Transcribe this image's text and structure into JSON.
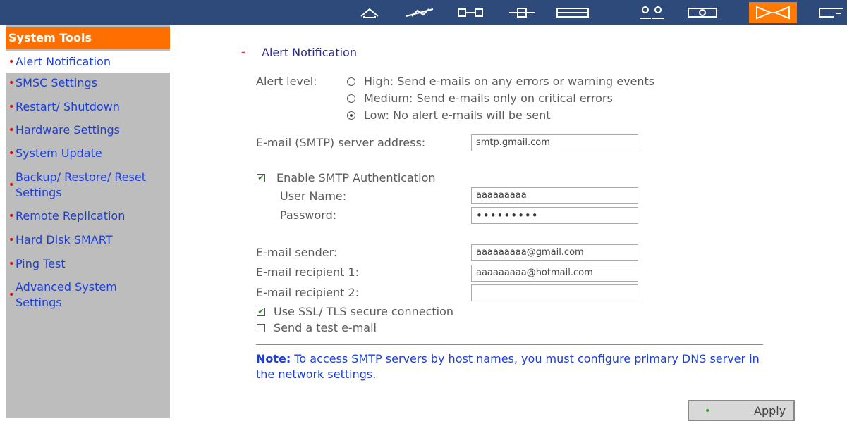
{
  "toolbar": {
    "icons": [
      "home-icon",
      "quick-config-icon",
      "system-settings-icon",
      "network-icon",
      "device-config-icon",
      "user-management-icon",
      "network-share-icon",
      "system-tools-icon",
      "logout-icon"
    ],
    "active_icon": "system-tools-icon",
    "accent_color": "#ff7a00",
    "background_color": "#2e4a7a"
  },
  "sidebar": {
    "title": "System Tools",
    "items": [
      {
        "label": "Alert Notification",
        "active": true
      },
      {
        "label": "SMSC Settings"
      },
      {
        "label": "Restart/ Shutdown"
      },
      {
        "label": "Hardware Settings"
      },
      {
        "label": "System Update"
      },
      {
        "label": "Backup/ Restore/ Reset Settings"
      },
      {
        "label": "Remote Replication"
      },
      {
        "label": "Hard Disk SMART"
      },
      {
        "label": "Ping Test"
      },
      {
        "label": "Advanced System Settings"
      }
    ],
    "title_color": "#ff6f00",
    "link_color": "#1c3fd6",
    "bullet": "•"
  },
  "main": {
    "section_dash": "-",
    "section_title": "Alert Notification",
    "alert_level_label": "Alert level:",
    "alert_options": [
      {
        "label": "High: Send e-mails on any errors or warning events",
        "selected": false
      },
      {
        "label": "Medium: Send e-mails only on critical errors",
        "selected": false
      },
      {
        "label": "Low: No alert e-mails will be sent",
        "selected": true
      }
    ],
    "smtp_server_label": "E-mail (SMTP) server address:",
    "smtp_server_value": "smtp.gmail.com",
    "enable_auth_label": "Enable SMTP Authentication",
    "enable_auth_checked": true,
    "username_label": "User Name:",
    "username_value": "aaaaaaaaa",
    "password_label": "Password:",
    "password_value": "•••••••••",
    "sender_label": "E-mail sender:",
    "sender_value": "aaaaaaaaa@gmail.com",
    "recipient1_label": "E-mail recipient 1:",
    "recipient1_value": "aaaaaaaaa@hotmail.com",
    "recipient2_label": "E-mail recipient 2:",
    "recipient2_value": "",
    "ssl_label": "Use SSL/ TLS secure connection",
    "ssl_checked": true,
    "test_email_label": "Send a test e-mail",
    "test_email_checked": false,
    "note_bold": "Note:",
    "note_text": " To access SMTP servers by host names, you must configure primary DNS server in the network settings.",
    "apply_label": "Apply",
    "apply_bullet": "•"
  }
}
